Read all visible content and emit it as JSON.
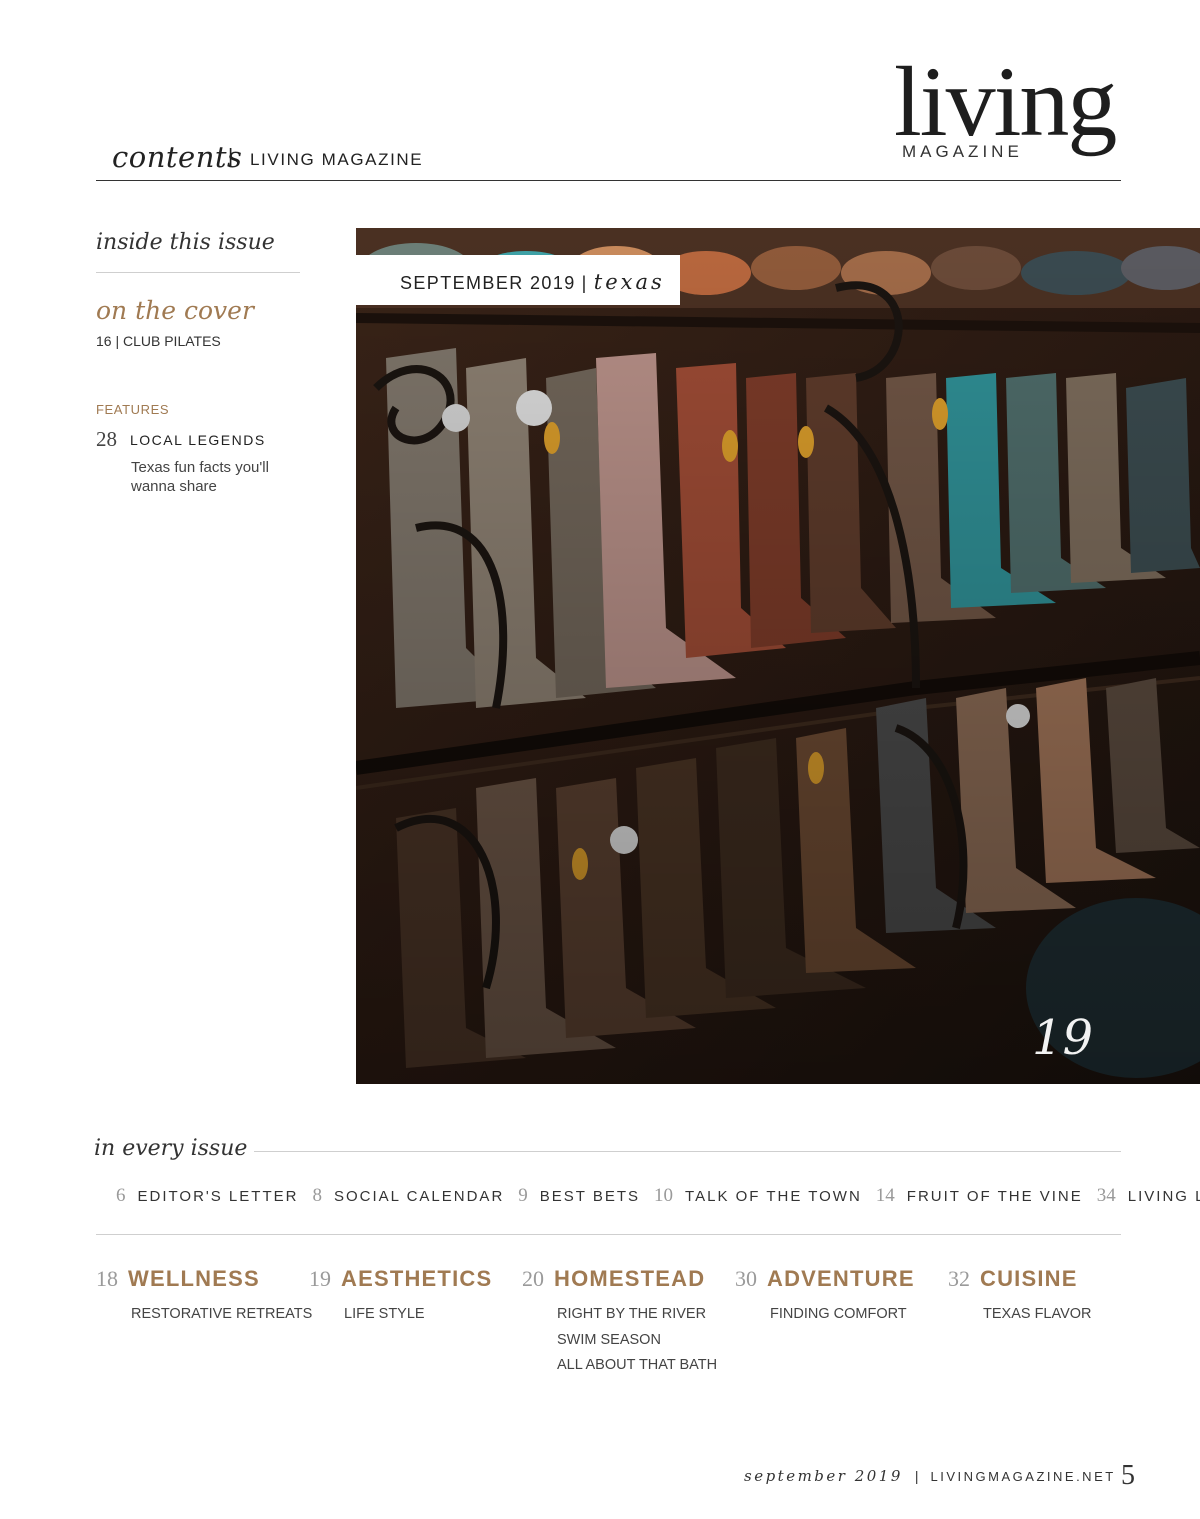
{
  "header": {
    "contents_label": "contents",
    "separator": "|",
    "magazine_label": "LIVING MAGAZINE"
  },
  "logo": {
    "word": "living",
    "subword": "MAGAZINE"
  },
  "left_column": {
    "inside_title": "inside this issue",
    "cover_heading": "on the cover",
    "cover_item": "16 | CLUB PILATES",
    "features_heading": "FEATURES",
    "feature": {
      "number": "28",
      "title": "LOCAL LEGENDS",
      "description": "Texas fun facts you'll wanna share"
    }
  },
  "photo": {
    "subject": "cowboy boots on display racks",
    "tag_date": "SEPTEMBER 2019",
    "tag_separator": "|",
    "tag_state": "texas",
    "page_number": "19"
  },
  "every_issue": {
    "title": "in every issue",
    "items": [
      {
        "number": "6",
        "label": "EDITOR'S LETTER"
      },
      {
        "number": "8",
        "label": "SOCIAL CALENDAR"
      },
      {
        "number": "9",
        "label": "BEST BETS"
      },
      {
        "number": "10",
        "label": "TALK OF THE TOWN"
      },
      {
        "number": "14",
        "label": "FRUIT OF THE VINE"
      },
      {
        "number": "34",
        "label": "LIVING LIKES"
      }
    ]
  },
  "departments": [
    {
      "number": "18",
      "title": "WELLNESS",
      "items": [
        "RESTORATIVE RETREATS"
      ]
    },
    {
      "number": "19",
      "title": "AESTHETICS",
      "items": [
        "LIFE STYLE"
      ]
    },
    {
      "number": "20",
      "title": "HOMESTEAD",
      "items": [
        "RIGHT BY THE RIVER",
        "SWIM SEASON",
        "ALL ABOUT THAT BATH"
      ]
    },
    {
      "number": "30",
      "title": "ADVENTURE",
      "items": [
        "FINDING COMFORT"
      ]
    },
    {
      "number": "32",
      "title": "CUISINE",
      "items": [
        "TEXAS FLAVOR"
      ]
    }
  ],
  "footer": {
    "date": "september 2019",
    "separator": "|",
    "site": "LIVINGMAGAZINE.NET",
    "page": "5"
  },
  "colors": {
    "accent": "#a07a52",
    "text": "#222222",
    "rule": "#cfcfcf"
  }
}
